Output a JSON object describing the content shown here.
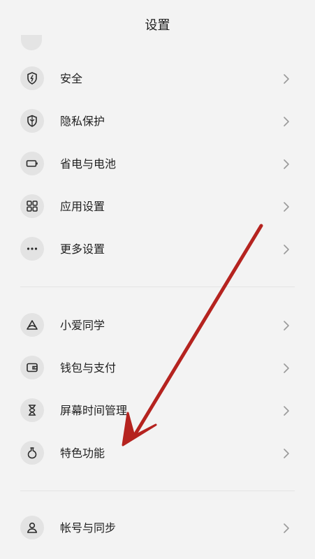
{
  "header": {
    "title": "设置"
  },
  "group1": [
    {
      "label": "安全",
      "icon": "shield-icon"
    },
    {
      "label": "隐私保护",
      "icon": "privacy-icon"
    },
    {
      "label": "省电与电池",
      "icon": "battery-icon"
    },
    {
      "label": "应用设置",
      "icon": "apps-grid-icon"
    },
    {
      "label": "更多设置",
      "icon": "more-dots-icon"
    }
  ],
  "group2": [
    {
      "label": "小爱同学",
      "icon": "xiaoai-icon"
    },
    {
      "label": "钱包与支付",
      "icon": "wallet-icon"
    },
    {
      "label": "屏幕时间管理",
      "icon": "hourglass-icon"
    },
    {
      "label": "特色功能",
      "icon": "flask-icon"
    }
  ],
  "group3": [
    {
      "label": "帐号与同步",
      "icon": "account-icon"
    }
  ],
  "colors": {
    "background": "#f3f3f3",
    "icon_bg": "#e3e3e3",
    "annotation_arrow": "#b5231f"
  }
}
